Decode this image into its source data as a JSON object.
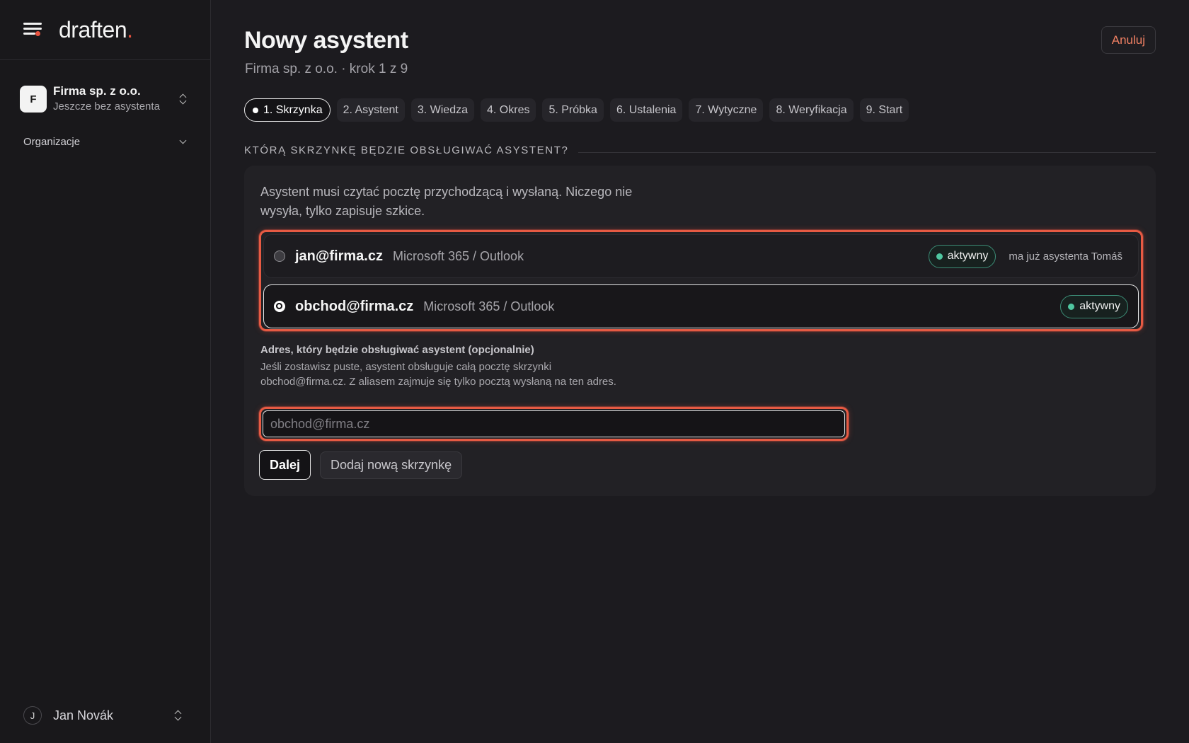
{
  "brand": {
    "name": "draften",
    "dot": ".",
    "accent": "#e8523f"
  },
  "sidebar": {
    "org": {
      "initial": "F",
      "name": "Firma sp. z o.o.",
      "status": "Jeszcze bez asystenta"
    },
    "section": "Organizacje",
    "user": {
      "initial": "J",
      "name": "Jan Novák"
    }
  },
  "header": {
    "title": "Nowy asystent",
    "subtitle": "Firma sp. z o.o. · krok 1 z 9",
    "cancel": "Anuluj"
  },
  "steps": [
    {
      "label": "1. Skrzynka",
      "active": true
    },
    {
      "label": "2. Asystent",
      "active": false
    },
    {
      "label": "3. Wiedza",
      "active": false
    },
    {
      "label": "4. Okres",
      "active": false
    },
    {
      "label": "5. Próbka",
      "active": false
    },
    {
      "label": "6. Ustalenia",
      "active": false
    },
    {
      "label": "7. Wytyczne",
      "active": false
    },
    {
      "label": "8. Weryfikacja",
      "active": false
    },
    {
      "label": "9. Start",
      "active": false
    }
  ],
  "section_heading": "KTÓRĄ SKRZYNKĘ BĘDZIE OBSŁUGIWAĆ ASYSTENT?",
  "card": {
    "description": "Asystent musi czytać pocztę przychodzącą i wysłaną. Niczego nie wysyła, tylko zapisuje szkice.",
    "mailboxes": [
      {
        "address": "jan@firma.cz",
        "provider": "Microsoft 365 / Outlook",
        "badge": "aktywny",
        "note": "ma już asystenta Tomáš",
        "selected": false
      },
      {
        "address": "obchod@firma.cz",
        "provider": "Microsoft 365 / Outlook",
        "badge": "aktywny",
        "note": "",
        "selected": true
      }
    ],
    "alias": {
      "label": "Adres, który będzie obsługiwać asystent (opcjonalnie)",
      "help": "Jeśli zostawisz puste, asystent obsługuje całą pocztę skrzynki obchod@firma.cz. Z aliasem zajmuje się tylko pocztą wysłaną na ten adres.",
      "value": "",
      "placeholder": "obchod@firma.cz"
    },
    "next_button": "Dalej",
    "add_button": "Dodaj nową skrzynkę"
  },
  "colors": {
    "background": "#1c1b1f",
    "sidebar": "#19181b",
    "highlight": "#e65a43",
    "badge_dot": "#4fc7a0",
    "cancel_text": "#f08063"
  }
}
